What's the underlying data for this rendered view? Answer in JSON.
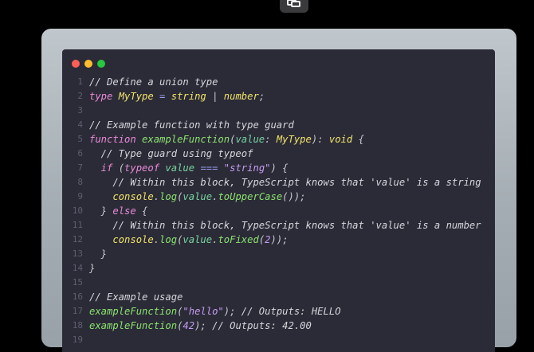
{
  "lines": [
    {
      "n": "1",
      "tokens": [
        [
          "c",
          "// Define a union type"
        ]
      ]
    },
    {
      "n": "2",
      "tokens": [
        [
          "k",
          "type "
        ],
        [
          "t",
          "MyType"
        ],
        [
          "o",
          " = "
        ],
        [
          "t",
          "string"
        ],
        [
          "p",
          " | "
        ],
        [
          "t",
          "number"
        ],
        [
          "p",
          ";"
        ]
      ]
    },
    {
      "n": "3",
      "tokens": []
    },
    {
      "n": "4",
      "tokens": [
        [
          "c",
          "// Example function with type guard"
        ]
      ]
    },
    {
      "n": "5",
      "tokens": [
        [
          "k",
          "function "
        ],
        [
          "f",
          "exampleFunction"
        ],
        [
          "p",
          "("
        ],
        [
          "v",
          "value"
        ],
        [
          "p",
          ": "
        ],
        [
          "t",
          "MyType"
        ],
        [
          "p",
          "): "
        ],
        [
          "t",
          "void"
        ],
        [
          "p",
          " {"
        ]
      ]
    },
    {
      "n": "6",
      "tokens": [
        [
          "c",
          "  // Type guard using typeof"
        ]
      ]
    },
    {
      "n": "7",
      "tokens": [
        [
          "k",
          "  if "
        ],
        [
          "p",
          "("
        ],
        [
          "k",
          "typeof "
        ],
        [
          "v",
          "value "
        ],
        [
          "o",
          "=== "
        ],
        [
          "s",
          "\"string\""
        ],
        [
          "p",
          ") {"
        ]
      ]
    },
    {
      "n": "8",
      "tokens": [
        [
          "c",
          "    // Within this block, TypeScript knows that 'value' is a string"
        ]
      ]
    },
    {
      "n": "9",
      "tokens": [
        [
          "t",
          "    console"
        ],
        [
          "p",
          "."
        ],
        [
          "f",
          "log"
        ],
        [
          "p",
          "("
        ],
        [
          "v",
          "value"
        ],
        [
          "p",
          "."
        ],
        [
          "f",
          "toUpperCase"
        ],
        [
          "p",
          "());"
        ]
      ]
    },
    {
      "n": "10",
      "tokens": [
        [
          "p",
          "  } "
        ],
        [
          "k",
          "else "
        ],
        [
          "p",
          "{"
        ]
      ]
    },
    {
      "n": "11",
      "tokens": [
        [
          "c",
          "    // Within this block, TypeScript knows that 'value' is a number"
        ]
      ]
    },
    {
      "n": "12",
      "tokens": [
        [
          "t",
          "    console"
        ],
        [
          "p",
          "."
        ],
        [
          "f",
          "log"
        ],
        [
          "p",
          "("
        ],
        [
          "v",
          "value"
        ],
        [
          "p",
          "."
        ],
        [
          "f",
          "toFixed"
        ],
        [
          "p",
          "("
        ],
        [
          "n",
          "2"
        ],
        [
          "p",
          "));"
        ]
      ]
    },
    {
      "n": "13",
      "tokens": [
        [
          "p",
          "  }"
        ]
      ]
    },
    {
      "n": "14",
      "tokens": [
        [
          "p",
          "}"
        ]
      ]
    },
    {
      "n": "15",
      "tokens": []
    },
    {
      "n": "16",
      "tokens": [
        [
          "c",
          "// Example usage"
        ]
      ]
    },
    {
      "n": "17",
      "tokens": [
        [
          "f",
          "exampleFunction"
        ],
        [
          "p",
          "("
        ],
        [
          "s",
          "\"hello\""
        ],
        [
          "p",
          "); "
        ],
        [
          "c",
          "// Outputs: HELLO"
        ]
      ]
    },
    {
      "n": "18",
      "tokens": [
        [
          "f",
          "exampleFunction"
        ],
        [
          "p",
          "("
        ],
        [
          "n",
          "42"
        ],
        [
          "p",
          "); "
        ],
        [
          "c",
          "// Outputs: 42.00"
        ]
      ]
    },
    {
      "n": "19",
      "tokens": []
    }
  ]
}
